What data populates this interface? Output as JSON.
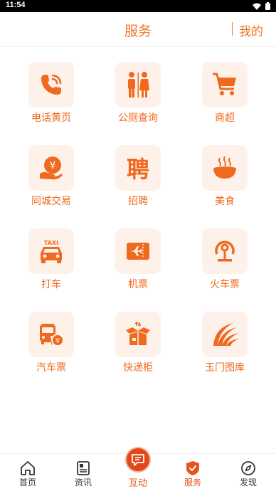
{
  "status_bar": {
    "time": "11:54"
  },
  "header": {
    "title": "服务",
    "right_link": "我的"
  },
  "services": [
    {
      "label": "电话黄页",
      "icon": "phone-icon"
    },
    {
      "label": "公厕查询",
      "icon": "restroom-icon"
    },
    {
      "label": "商超",
      "icon": "shopping-cart-icon"
    },
    {
      "label": "同城交易",
      "icon": "yuan-trade-icon"
    },
    {
      "label": "招聘",
      "icon": "recruit-icon",
      "glyph": "聘"
    },
    {
      "label": "美食",
      "icon": "food-bowl-icon"
    },
    {
      "label": "打车",
      "icon": "taxi-icon",
      "glyph": "TAXI"
    },
    {
      "label": "机票",
      "icon": "plane-ticket-icon"
    },
    {
      "label": "火车票",
      "icon": "train-logo-icon"
    },
    {
      "label": "汽车票",
      "icon": "bus-ticket-icon",
      "glyph": "¥"
    },
    {
      "label": "快递柜",
      "icon": "parcel-box-icon"
    },
    {
      "label": "玉门图库",
      "icon": "gallery-swirl-icon"
    }
  ],
  "tabs": [
    {
      "label": "首页",
      "icon": "home-icon",
      "active": false
    },
    {
      "label": "资讯",
      "icon": "news-icon",
      "active": false
    },
    {
      "label": "互动",
      "icon": "chat-icon",
      "active": false
    },
    {
      "label": "服务",
      "icon": "service-shield-icon",
      "active": true
    },
    {
      "label": "发现",
      "icon": "compass-icon",
      "active": false
    }
  ],
  "colors": {
    "accent": "#f07428",
    "tile_bg": "#fdf1ea",
    "active_tab": "#e8541c"
  }
}
